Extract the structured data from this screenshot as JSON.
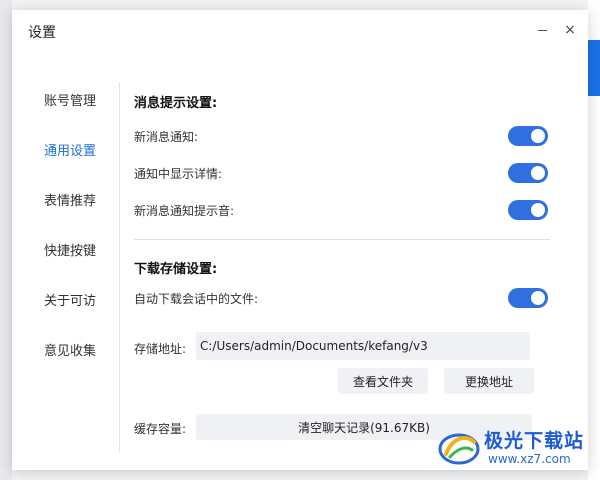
{
  "window": {
    "title": "设置",
    "minimize_label": "",
    "close_label": "×"
  },
  "nav": {
    "items": [
      {
        "label": "账号管理",
        "active": false
      },
      {
        "label": "通用设置",
        "active": true
      },
      {
        "label": "表情推荐",
        "active": false
      },
      {
        "label": "快捷按键",
        "active": false
      },
      {
        "label": "关于可访",
        "active": false
      },
      {
        "label": "意见收集",
        "active": false
      }
    ]
  },
  "message_settings": {
    "title": "消息提示设置:",
    "rows": [
      {
        "label": "新消息通知:",
        "enabled": true
      },
      {
        "label": "通知中显示详情:",
        "enabled": true
      },
      {
        "label": "新消息通知提示音:",
        "enabled": true
      }
    ]
  },
  "download_settings": {
    "title": "下载存储设置:",
    "auto_download": {
      "label": "自动下载会话中的文件:",
      "enabled": true
    },
    "storage_path": {
      "label": "存储地址:",
      "value": "C:/Users/admin/Documents/kefang/v3"
    },
    "open_folder_label": "查看文件夹",
    "change_path_label": "更换地址",
    "cache": {
      "label": "缓存容量:",
      "clear_label": "清空聊天记录(91.67KB)"
    }
  },
  "watermark": {
    "brand": "极光下载站",
    "url": "www.xz7.com"
  },
  "colors": {
    "accent": "#1e6fe0",
    "toggle_on": "#2f6fe0",
    "button_bg": "#f0f1f4"
  }
}
